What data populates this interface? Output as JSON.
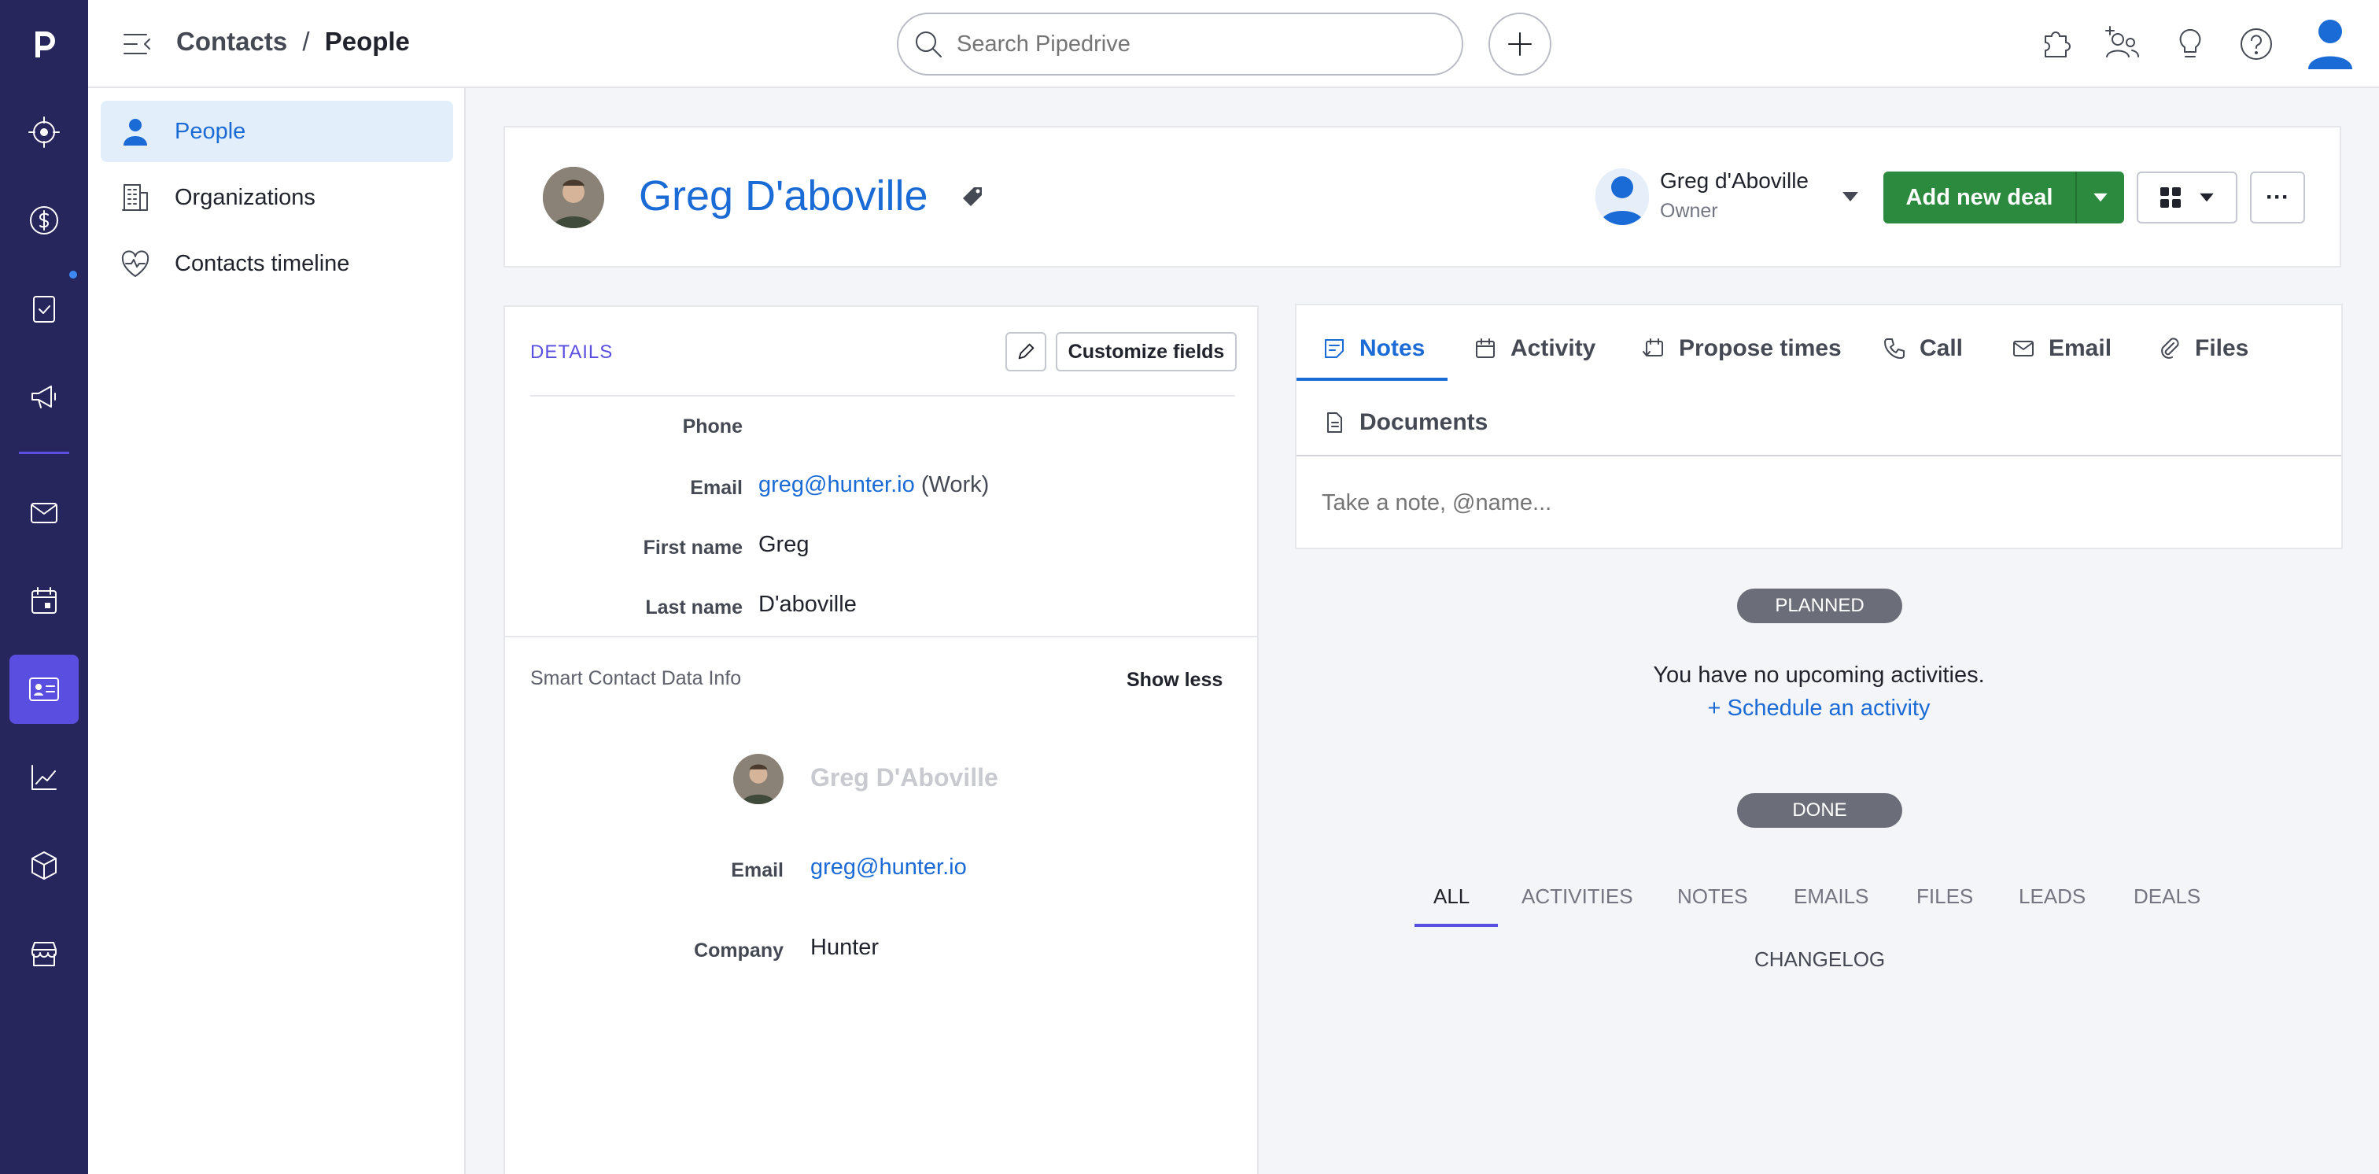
{
  "breadcrumb": {
    "parent": "Contacts",
    "separator": "/",
    "current": "People"
  },
  "search": {
    "placeholder": "Search Pipedrive"
  },
  "subnav": {
    "items": [
      {
        "label": "People"
      },
      {
        "label": "Organizations"
      },
      {
        "label": "Contacts timeline"
      }
    ]
  },
  "person": {
    "name": "Greg D'aboville",
    "owner_name": "Greg d'Aboville",
    "owner_role": "Owner",
    "add_deal_label": "Add new deal",
    "more_label": "···"
  },
  "details": {
    "heading": "DETAILS",
    "customize_label": "Customize fields",
    "fields": {
      "phone_label": "Phone",
      "email_label": "Email",
      "email_value": "greg@hunter.io",
      "email_type": "(Work)",
      "first_name_label": "First name",
      "first_name_value": "Greg",
      "last_name_label": "Last name",
      "last_name_value": "D'aboville"
    }
  },
  "smart": {
    "title": "Smart Contact Data Info",
    "show_less": "Show less",
    "name": "Greg D'Aboville",
    "email_label": "Email",
    "email_value": "greg@hunter.io",
    "company_label": "Company",
    "company_value": "Hunter"
  },
  "composer": {
    "tabs": [
      {
        "label": "Notes"
      },
      {
        "label": "Activity"
      },
      {
        "label": "Propose times"
      },
      {
        "label": "Call"
      },
      {
        "label": "Email"
      },
      {
        "label": "Files"
      },
      {
        "label": "Documents"
      }
    ],
    "note_placeholder": "Take a note, @name..."
  },
  "planned": {
    "pill": "PLANNED",
    "empty_text": "You have no upcoming activities.",
    "schedule_link": "+ Schedule an activity"
  },
  "done": {
    "pill": "DONE"
  },
  "history_tabs": [
    {
      "label": "ALL"
    },
    {
      "label": "ACTIVITIES"
    },
    {
      "label": "NOTES"
    },
    {
      "label": "EMAILS"
    },
    {
      "label": "FILES"
    },
    {
      "label": "LEADS"
    },
    {
      "label": "DEALS"
    },
    {
      "label": "CHANGELOG"
    }
  ],
  "colors": {
    "rail": "#26265c",
    "rail_active": "#5a4ee0",
    "accent": "#1a6bd6",
    "deal_green": "#2b8a3e"
  }
}
